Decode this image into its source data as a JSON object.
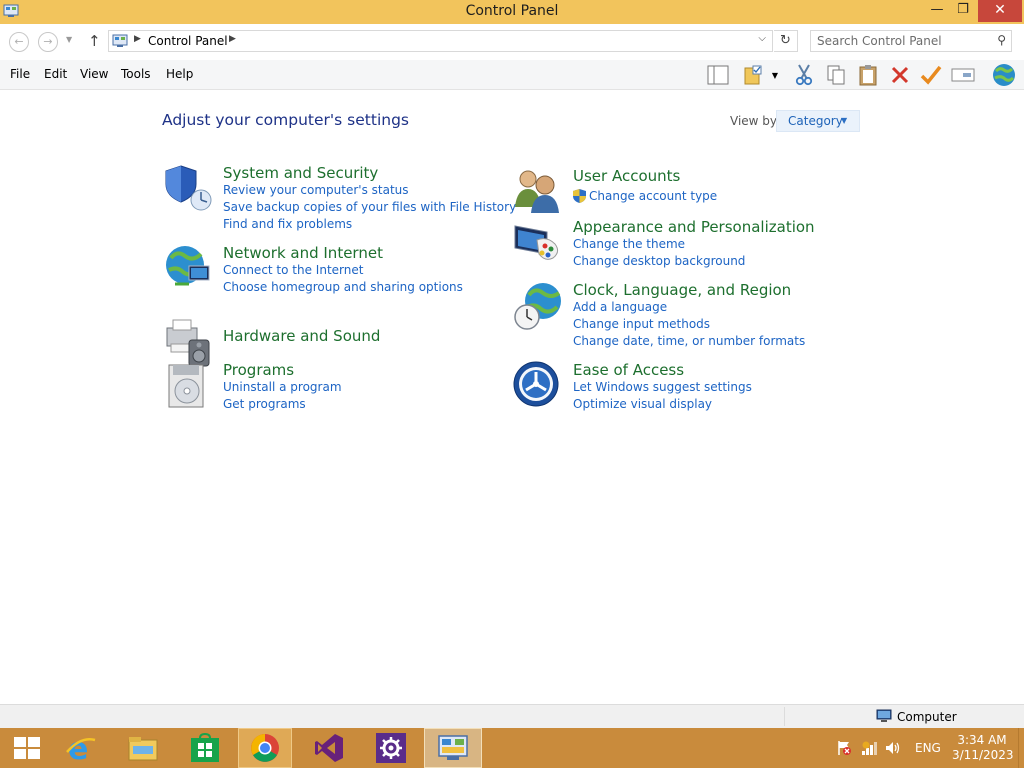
{
  "window": {
    "title": "Control Panel",
    "minimize": "—",
    "maximize": "❐",
    "close": "✕"
  },
  "address": {
    "breadcrumb": "Control Panel",
    "search_placeholder": "Search Control Panel"
  },
  "menu": [
    "File",
    "Edit",
    "View",
    "Tools",
    "Help"
  ],
  "content": {
    "heading": "Adjust your computer's settings",
    "view_by_label": "View by:",
    "view_by_value": "Category",
    "categories": [
      {
        "title": "System and Security",
        "icon": "shield-icon",
        "links": [
          "Review your computer's status",
          "Save backup copies of your files with File History",
          "Find and fix problems"
        ]
      },
      {
        "title": "Network and Internet",
        "icon": "network-globe-icon",
        "links": [
          "Connect to the Internet",
          "Choose homegroup and sharing options"
        ]
      },
      {
        "title": "Hardware and Sound",
        "icon": "printer-speaker-icon",
        "links": []
      },
      {
        "title": "Programs",
        "icon": "programs-disc-icon",
        "links": [
          "Uninstall a program",
          "Get programs"
        ]
      },
      {
        "title": "User Accounts",
        "icon": "users-icon",
        "links": [
          "Change account type"
        ]
      },
      {
        "title": "Appearance and Personalization",
        "icon": "monitor-palette-icon",
        "links": [
          "Change the theme",
          "Change desktop background"
        ]
      },
      {
        "title": "Clock, Language, and Region",
        "icon": "clock-globe-icon",
        "links": [
          "Add a language",
          "Change input methods",
          "Change date, time, or number formats"
        ]
      },
      {
        "title": "Ease of Access",
        "icon": "ease-of-access-icon",
        "links": [
          "Let Windows suggest settings",
          "Optimize visual display"
        ]
      }
    ]
  },
  "statusbar": {
    "text": "Computer"
  },
  "taskbar": {
    "apps": [
      "file-explorer-start-icon",
      "internet-explorer-icon",
      "file-explorer-icon",
      "windows-store-icon",
      "chrome-icon",
      "visual-studio-icon",
      "settings-gear-icon",
      "control-panel-icon"
    ],
    "language": "ENG",
    "time": "3:34 AM",
    "date": "3/11/2023"
  },
  "colors": {
    "titlebar": "#f2c45c",
    "taskbar": "#c98b3c",
    "category_title": "#1d6f2e",
    "link": "#1d64c4",
    "heading": "#1e3287"
  }
}
